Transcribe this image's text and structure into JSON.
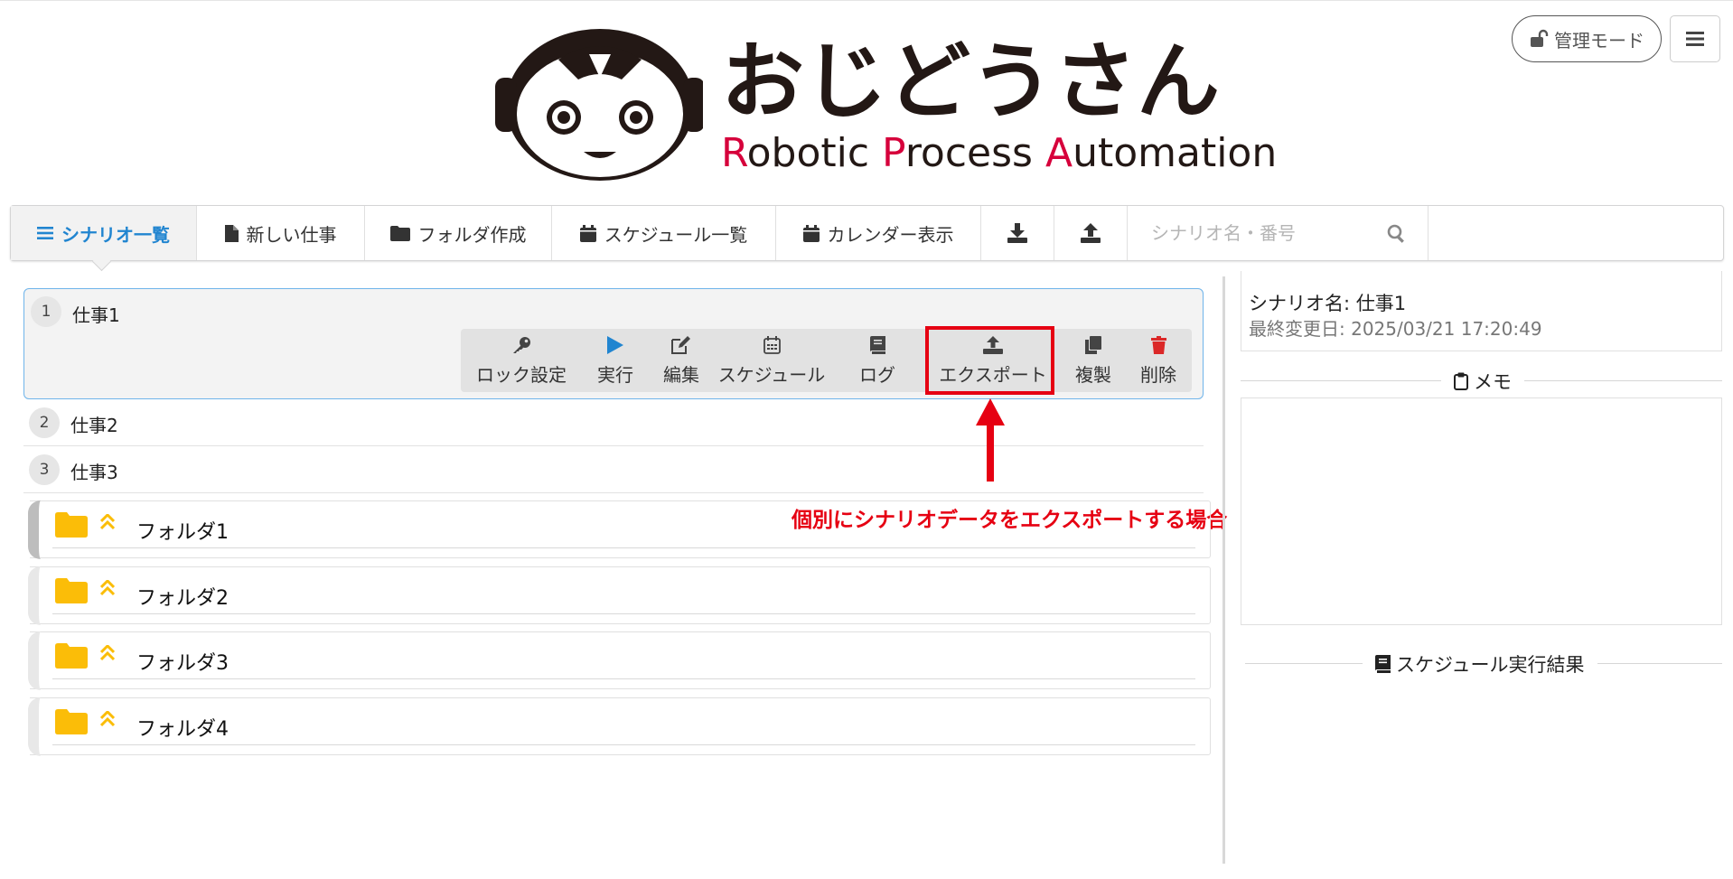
{
  "header": {
    "logo_title": "おじどうさん",
    "logo_sub_parts": [
      "R",
      "obotic ",
      "P",
      "rocess ",
      "A",
      "utomation"
    ],
    "admin_mode_label": "管理モード"
  },
  "toolbar": {
    "items": [
      {
        "label": "シナリオ一覧"
      },
      {
        "label": "新しい仕事"
      },
      {
        "label": "フォルダ作成"
      },
      {
        "label": "スケジュール一覧"
      },
      {
        "label": "カレンダー表示"
      }
    ],
    "search_placeholder": "シナリオ名・番号"
  },
  "scenarios": [
    {
      "number": "1",
      "name": "仕事1"
    },
    {
      "number": "2",
      "name": "仕事2"
    },
    {
      "number": "3",
      "name": "仕事3"
    }
  ],
  "actions": {
    "lock": "ロック設定",
    "run": "実行",
    "edit": "編集",
    "schedule": "スケジュール",
    "log": "ログ",
    "export": "エクスポート",
    "duplicate": "複製",
    "delete": "削除"
  },
  "annotation": "個別にシナリオデータをエクスポートする場合",
  "folders": [
    {
      "name": "フォルダ1"
    },
    {
      "name": "フォルダ2"
    },
    {
      "name": "フォルダ3"
    },
    {
      "name": "フォルダ4"
    }
  ],
  "detail": {
    "scenario_name": "シナリオ名: 仕事1",
    "last_modified": "最終変更日: 2025/03/21 17:20:49",
    "memo_title": "メモ",
    "schedule_result_title": "スケジュール実行結果"
  },
  "colors": {
    "accent_blue": "#2185d0",
    "annotation_red": "#e60012",
    "folder_yellow": "#fbbd08",
    "delete_red": "#db2828",
    "logo_red": "#d6003b"
  }
}
